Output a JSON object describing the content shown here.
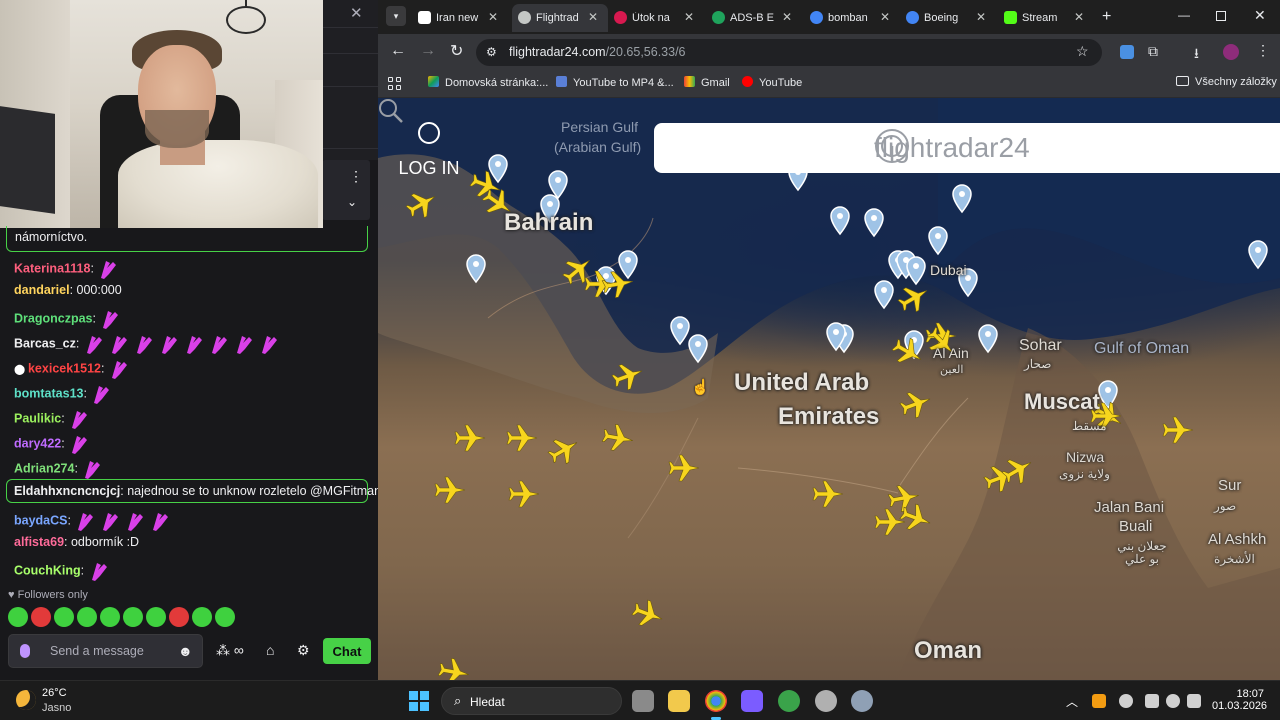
{
  "chat": {
    "pinned_message": "námorníctvo.",
    "lines": [
      {
        "user": "Katerina1118",
        "color": "#ff5f7e",
        "text": "",
        "emotes": 1
      },
      {
        "user": "dandariel",
        "color": "#ffd45e",
        "text": "000:000",
        "emotes": 0
      },
      {
        "user": "Dragonczpas",
        "color": "#5ee07a",
        "text": "",
        "emotes": 1
      },
      {
        "user": "Barcas_cz",
        "color": "#efeff1",
        "text": "",
        "emotes": 8
      },
      {
        "user": "kexicek1512",
        "color": "#ff4444",
        "text": "",
        "emotes": 1
      },
      {
        "user": "bomtatas13",
        "color": "#5ee0c8",
        "text": "",
        "emotes": 1
      },
      {
        "user": "Paulikic",
        "color": "#9bf05e",
        "text": "",
        "emotes": 1
      },
      {
        "user": "dary422",
        "color": "#bf6bff",
        "text": "",
        "emotes": 1
      },
      {
        "user": "Adrian274",
        "color": "#7fe07a",
        "text": "",
        "emotes": 1
      },
      {
        "user": "Eldahhxncncncjcj",
        "color": "#efeff1",
        "text": "najednou se to unknow rozletelo @MGFitman .",
        "emotes": 0
      },
      {
        "user": "baydaCS",
        "color": "#7aa6ff",
        "text": "",
        "emotes": 4
      },
      {
        "user": "alfista69",
        "color": "#ff6b9a",
        "text": "odbormík :D",
        "emotes": 0
      },
      {
        "user": "CouchKing",
        "color": "#a8ff6b",
        "text": "",
        "emotes": 1
      }
    ],
    "followers_only": "Followers only",
    "input_placeholder": "Send a message",
    "chat_button": "Chat",
    "colors": {
      "accent": "#47d147",
      "emote": "#d940e8"
    }
  },
  "browser": {
    "tabs": [
      {
        "title": "Iran new",
        "favicon": "icon-i",
        "active": false
      },
      {
        "title": "Flightrad",
        "favicon": "flightradar-icon",
        "active": true
      },
      {
        "title": "Útok na",
        "favicon": "icon-in",
        "active": false
      },
      {
        "title": "ADS-B E",
        "favicon": "adsb-icon",
        "active": false
      },
      {
        "title": "bomban",
        "favicon": "google-icon",
        "active": false
      },
      {
        "title": "Boeing",
        "favicon": "google-icon",
        "active": false
      },
      {
        "title": "Stream",
        "favicon": "kick-icon",
        "active": false
      }
    ],
    "url_host": "flightradar24.com",
    "url_path": "/20.65,56.33/6",
    "bookmarks": [
      {
        "label": "Domovská stránka:..."
      },
      {
        "label": "YouTube to MP4 &..."
      },
      {
        "label": "Gmail"
      },
      {
        "label": "YouTube"
      }
    ],
    "all_bookmarks": "Všechny záložky"
  },
  "map": {
    "login_label": "LOG IN",
    "logo_text": "flightradar24",
    "labels": {
      "bahrain": "Bahrain",
      "uae_line1": "United Arab",
      "uae_line2": "Emirates",
      "oman": "Oman",
      "dubai": "Dubai",
      "al_ain": "Al Ain",
      "al_ain_ar": "العين",
      "sohar": "Sohar",
      "sohar_ar": "صحار",
      "muscat": "Muscat",
      "muscat_ar": "مسقط",
      "gulf_of_oman": "Gulf of Oman",
      "nizwa": "Nizwa",
      "nizwa_ar": "ولاية نزوى",
      "jalan_line1": "Jalan Bani",
      "jalan_line2": "Buali",
      "jalan_ar": "جعلان بني بو علي",
      "sur": "Sur",
      "sur_ar": "صور",
      "al_ashkh": "Al Ashkh",
      "al_ashkh_ar": "الأشخرة",
      "persian_gulf": "Persian Gulf",
      "arabian_gulf": "(Arabian Gulf)"
    },
    "colors": {
      "plane": "#f7d51d",
      "pin": "#9fc3e6"
    }
  },
  "taskbar": {
    "temperature": "26°C",
    "condition": "Jasno",
    "search_label": "Hledat",
    "time": "18:07",
    "date": "01.03.2026"
  }
}
